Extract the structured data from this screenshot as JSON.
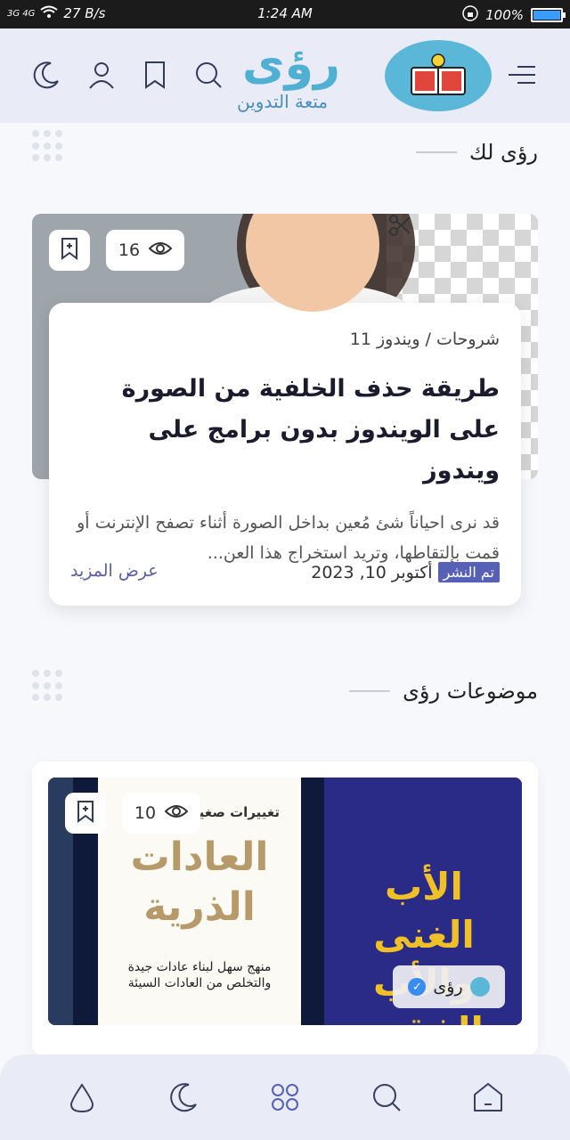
{
  "status_bar": {
    "network": "3G 4G",
    "speed": "27 B/s",
    "time": "1:24 AM",
    "battery": "100%"
  },
  "header": {
    "logo_word": "رؤى",
    "logo_tagline": "متعة التدوين",
    "icons": [
      "moon-icon",
      "user-icon",
      "bookmark-icon",
      "search-icon",
      "menu-icon"
    ]
  },
  "sections": {
    "for_you": "رؤى لك",
    "topics": "موضوعات رؤى"
  },
  "featured": {
    "views": "16",
    "category": "شروحات / ويندوز 11",
    "title": "طريقة حذف الخلفية من الصورة على الويندوز بدون برامج على ويندوز",
    "excerpt": "قد نرى احياناً شئ مُعين بداخل الصورة أثناء تصفح الإنترنت أو قمت بإلتقاطها، وتريد استخراج هذا العن...",
    "published_label": "تم النشر",
    "date": "أكتوبر 10, 2023",
    "more_label": "عرض المزيد"
  },
  "topic_card": {
    "views": "10",
    "book_left_top": "تغييرات صغيرة",
    "book_left_title": "العادات الذرية",
    "book_left_sub": "منهج سهل لبناء عادات جيدة والتخلص من العادات السيئة",
    "book_right_title": "الأب الغنى والأب الفقير",
    "author": "رؤى"
  },
  "bottom_nav": [
    "home-icon",
    "search-icon",
    "grid-icon",
    "moon-icon",
    "drop-icon"
  ],
  "colors": {
    "header_bg": "#e9ecf7",
    "accent": "#5560b6",
    "logo_blue": "#4fb0d4"
  }
}
